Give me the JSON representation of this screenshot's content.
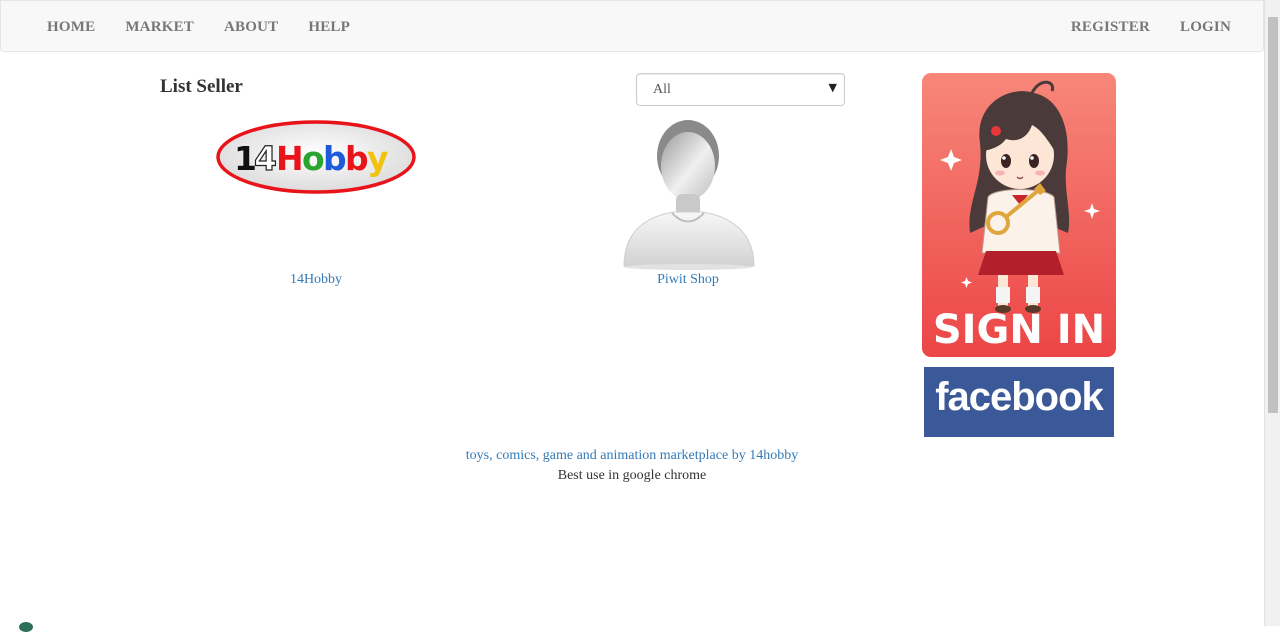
{
  "nav": {
    "left": [
      "HOME",
      "MARKET",
      "ABOUT",
      "HELP"
    ],
    "right": [
      "REGISTER",
      "LOGIN"
    ]
  },
  "main": {
    "heading": "List Seller",
    "filter": {
      "selected": "All"
    },
    "sellers": [
      {
        "name": "14Hobby",
        "logo_text": "14Hobby"
      },
      {
        "name": "Piwit Shop"
      }
    ]
  },
  "sidebar": {
    "signin_banner_text": "SIGN IN",
    "facebook_text": "facebook"
  },
  "footer": {
    "link": "toys, comics, game and animation marketplace by 14hobby",
    "note": "Best use in google chrome"
  },
  "colors": {
    "link": "#337ab7",
    "nav_text": "#777777",
    "facebook": "#3b5998",
    "signin_bg": "#f0504f"
  }
}
